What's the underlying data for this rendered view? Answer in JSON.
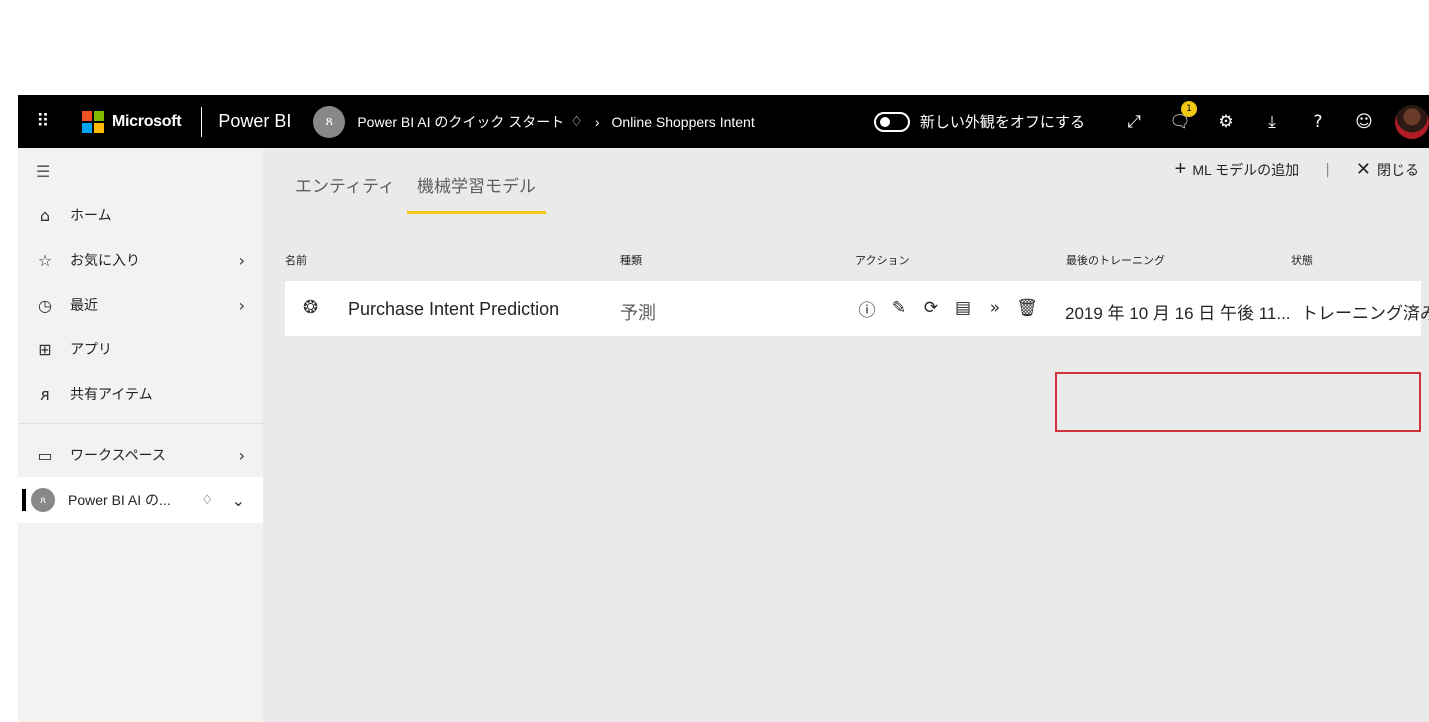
{
  "topbar": {
    "brand": "Microsoft",
    "product": "Power BI",
    "workspace_crumb": "Power BI AI のクイック スタート",
    "dataflow_crumb": "Online Shoppers Intent",
    "toggle_label": "新しい外観をオフにする",
    "notification_count": "1",
    "help_glyph": "?"
  },
  "sidebar": {
    "items": [
      {
        "label": "ホーム",
        "icon": "home-icon"
      },
      {
        "label": "お気に入り",
        "icon": "star-icon"
      },
      {
        "label": "最近",
        "icon": "clock-icon"
      },
      {
        "label": "アプリ",
        "icon": "apps-icon"
      },
      {
        "label": "共有アイテム",
        "icon": "shared-icon"
      },
      {
        "label": "ワークスペース",
        "icon": "workspaces-icon"
      },
      {
        "label": "Power BI AI の...",
        "icon": "workspace-avatar-icon"
      }
    ]
  },
  "tabs": [
    {
      "label": "エンティティ",
      "active": false
    },
    {
      "label": "機械学習モデル",
      "active": true
    }
  ],
  "commands": {
    "add_model": "ML モデルの追加",
    "close": "閉じる"
  },
  "table": {
    "headers": {
      "name": "名前",
      "type": "種類",
      "actions": "アクション",
      "last_training": "最後のトレーニング",
      "status": "状態"
    },
    "rows": [
      {
        "name": "Purchase Intent Prediction",
        "type": "予測",
        "last_training": "2019 年 10 月 16 日 午後 11...",
        "status": "トレーニング済み"
      }
    ]
  },
  "colors": {
    "topbar_bg": "#000000",
    "accent_yellow": "#f2c811",
    "highlight_red": "#d13438",
    "sidebar_bg": "#f3f2f1",
    "content_bg": "#eaeaea"
  }
}
